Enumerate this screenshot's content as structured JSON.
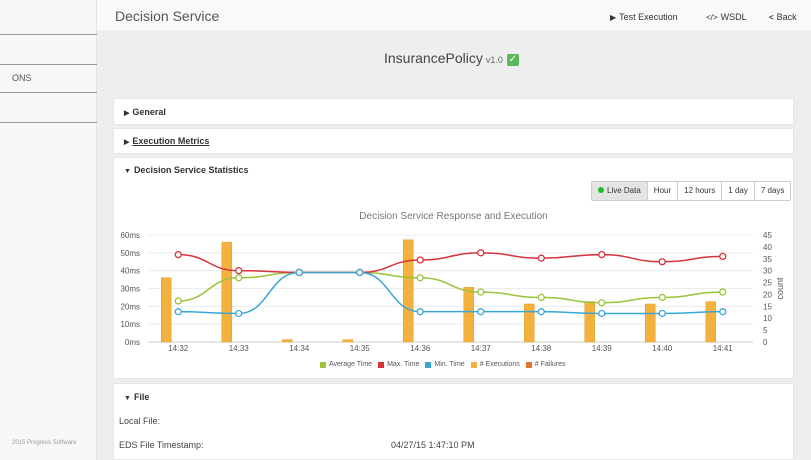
{
  "sidebar": {
    "item_label": "ONS",
    "copyright": "2015 Progress Software"
  },
  "header": {
    "title": "Decision Service",
    "test_execution": "Test Execution",
    "wsdl": "WSDL",
    "back": "Back"
  },
  "policy": {
    "name": "InsurancePolicy",
    "version": "v1.0",
    "status": "valid-check"
  },
  "sections": {
    "general": "General",
    "metrics": "Execution Metrics",
    "stats": "Decision Service Statistics",
    "file": "File"
  },
  "time_range": {
    "live": "Live Data",
    "hour": "Hour",
    "h12": "12 hours",
    "day": "1 day",
    "days7": "7 days",
    "selected": "Live Data"
  },
  "file": {
    "local_label": "Local File:",
    "local_value": "",
    "eds_label": "EDS File Timestamp:",
    "eds_value": "04/27/15 1:47:10 PM"
  },
  "colors": {
    "average": "#9ac43a",
    "max": "#d8323c",
    "min": "#3aa6d8",
    "executions": "#f4b13e",
    "failures": "#e0742c"
  },
  "chart_data": {
    "type": "bar+line",
    "title": "Decision Service Response and Execution",
    "categories": [
      "14:32",
      "14:33",
      "14:34",
      "14:35",
      "14:36",
      "14:37",
      "14:38",
      "14:39",
      "14:40",
      "14:41"
    ],
    "y_left": {
      "ticks": [
        "0ms",
        "10ms",
        "20ms",
        "30ms",
        "40ms",
        "50ms",
        "60ms"
      ],
      "range": [
        0,
        60
      ],
      "unit": "ms"
    },
    "y_right": {
      "label": "count",
      "ticks": [
        "0",
        "5",
        "10",
        "15",
        "20",
        "25",
        "30",
        "35",
        "40",
        "45"
      ],
      "range": [
        0,
        45
      ]
    },
    "legend": [
      "Average Time",
      "Max. Time",
      "Min. Time",
      "# Executions",
      "# Failures"
    ],
    "line_series": [
      {
        "name": "Average Time",
        "values": [
          23,
          36,
          39,
          39,
          36,
          28,
          25,
          22,
          25,
          28
        ]
      },
      {
        "name": "Max. Time",
        "values": [
          49,
          40,
          39,
          39,
          46,
          50,
          47,
          49,
          45,
          48
        ]
      },
      {
        "name": "Min. Time",
        "values": [
          17,
          16,
          39,
          39,
          17,
          17,
          17,
          16,
          16,
          17
        ]
      }
    ],
    "bar_series": [
      {
        "name": "# Executions",
        "values": [
          27,
          42,
          1,
          1,
          43,
          23,
          16,
          17,
          16,
          17
        ]
      },
      {
        "name": "# Failures",
        "values": [
          0,
          0,
          0,
          0,
          0,
          0,
          0,
          0,
          0,
          0
        ]
      }
    ]
  }
}
